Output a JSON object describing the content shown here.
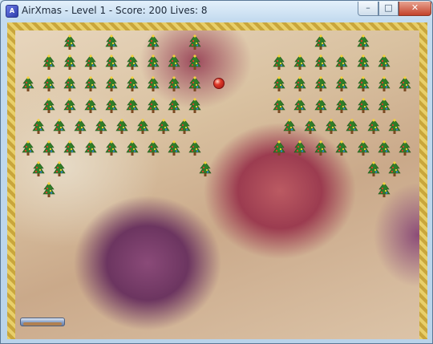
{
  "window": {
    "title": "AirXmas - Level 1 -  Score: 200 Lives: 8",
    "app_icon": "air-icon",
    "buttons": {
      "minimize": "–",
      "maximize": "□",
      "close": "✕"
    }
  },
  "game": {
    "level": 1,
    "score": 200,
    "lives": 8,
    "brick_icon": "christmas-tree-icon",
    "ball_color": "#d42a1c",
    "border_color": "#d8b84c"
  }
}
